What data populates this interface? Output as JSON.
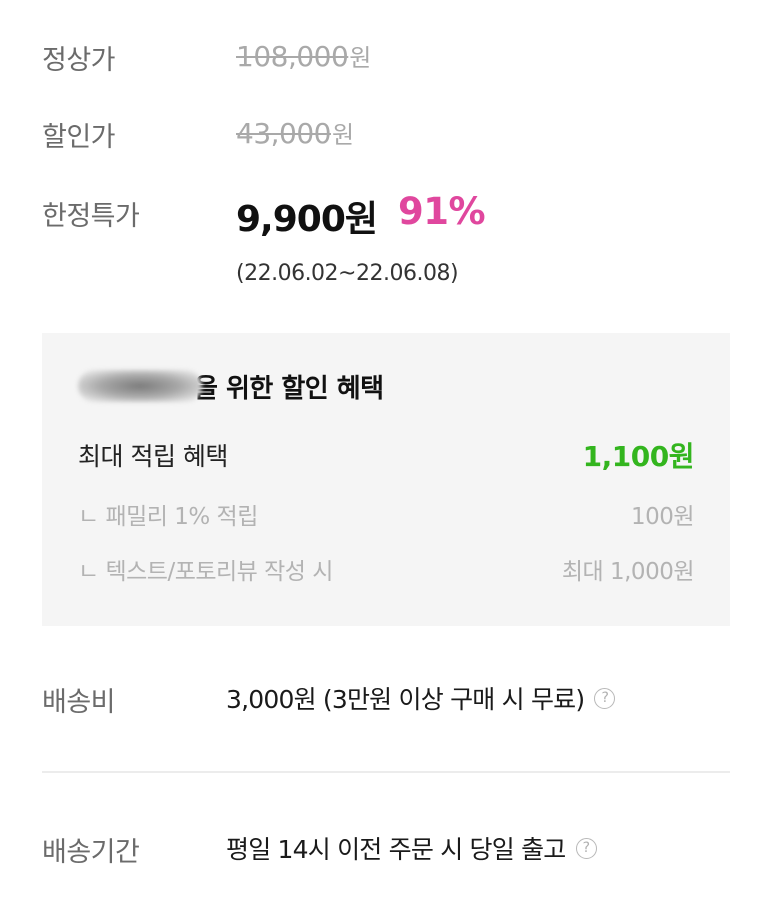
{
  "prices": {
    "regular": {
      "label": "정상가",
      "amount": "108,000",
      "unit": "원"
    },
    "discount": {
      "label": "할인가",
      "amount": "43,000",
      "unit": "원"
    },
    "special": {
      "label": "한정특가",
      "price": "9,900원",
      "rate": "91%",
      "period": "(22.06.02~22.06.08)"
    }
  },
  "benefits": {
    "title_suffix": "을 위한 할인 혜택",
    "max_label": "최대 적립 혜택",
    "max_value": "1,100원",
    "family_label": "ㄴ 패밀리 1% 적립",
    "family_value": "100원",
    "review_label": "ㄴ 텍스트/포토리뷰 작성 시",
    "review_value": "최대 1,000원"
  },
  "shipping": {
    "fee_label": "배송비",
    "fee_value": "3,000원 (3만원 이상 구매 시 무료)",
    "period_label": "배송기간",
    "period_value": "평일 14시 이전 주문 시 당일 출고"
  },
  "icons": {
    "help": "?"
  },
  "colors": {
    "rate": "#e0479e",
    "points": "#33b51e"
  }
}
